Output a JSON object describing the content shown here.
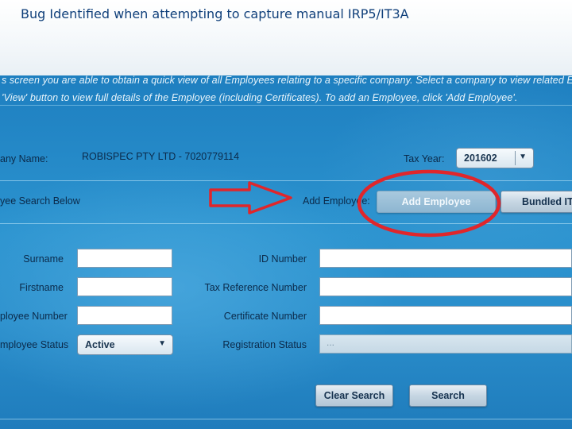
{
  "slide": {
    "title": "Bug Identified when attempting to capture manual IRP5/IT3A"
  },
  "screen": {
    "instructions_line1": "s screen you are able to obtain a quick view of all Employees relating to a specific company. Select a company to view related Employees.",
    "instructions_line2": "'View' button to view full details of the Employee (including Certificates). To add an Employee, click 'Add Employee'.",
    "company_label": "any Name:",
    "company_value": "ROBISPEC PTY LTD - 7020779114",
    "tax_year_label": "Tax Year:",
    "tax_year_value": "201602",
    "search_hint": "yee Search Below",
    "add_employee_label": "Add Employee:",
    "add_employee_button": "Add Employee",
    "bundled_button": "Bundled IT",
    "fields": {
      "surname_label": "Surname",
      "firstname_label": "Firstname",
      "employee_number_label": "ployee Number",
      "employee_status_label": "mployee Status",
      "employee_status_value": "Active",
      "id_number_label": "ID Number",
      "tax_reference_label": "Tax Reference Number",
      "certificate_number_label": "Certificate Number",
      "registration_status_label": "Registration Status",
      "registration_status_value": "..."
    },
    "clear_search_button": "Clear Search",
    "search_button": "Search"
  },
  "annotations": {
    "arrow_color": "#e0262b",
    "circle_color": "#e0262b"
  },
  "icons": {
    "dropdown": "chevron-down-icon"
  }
}
